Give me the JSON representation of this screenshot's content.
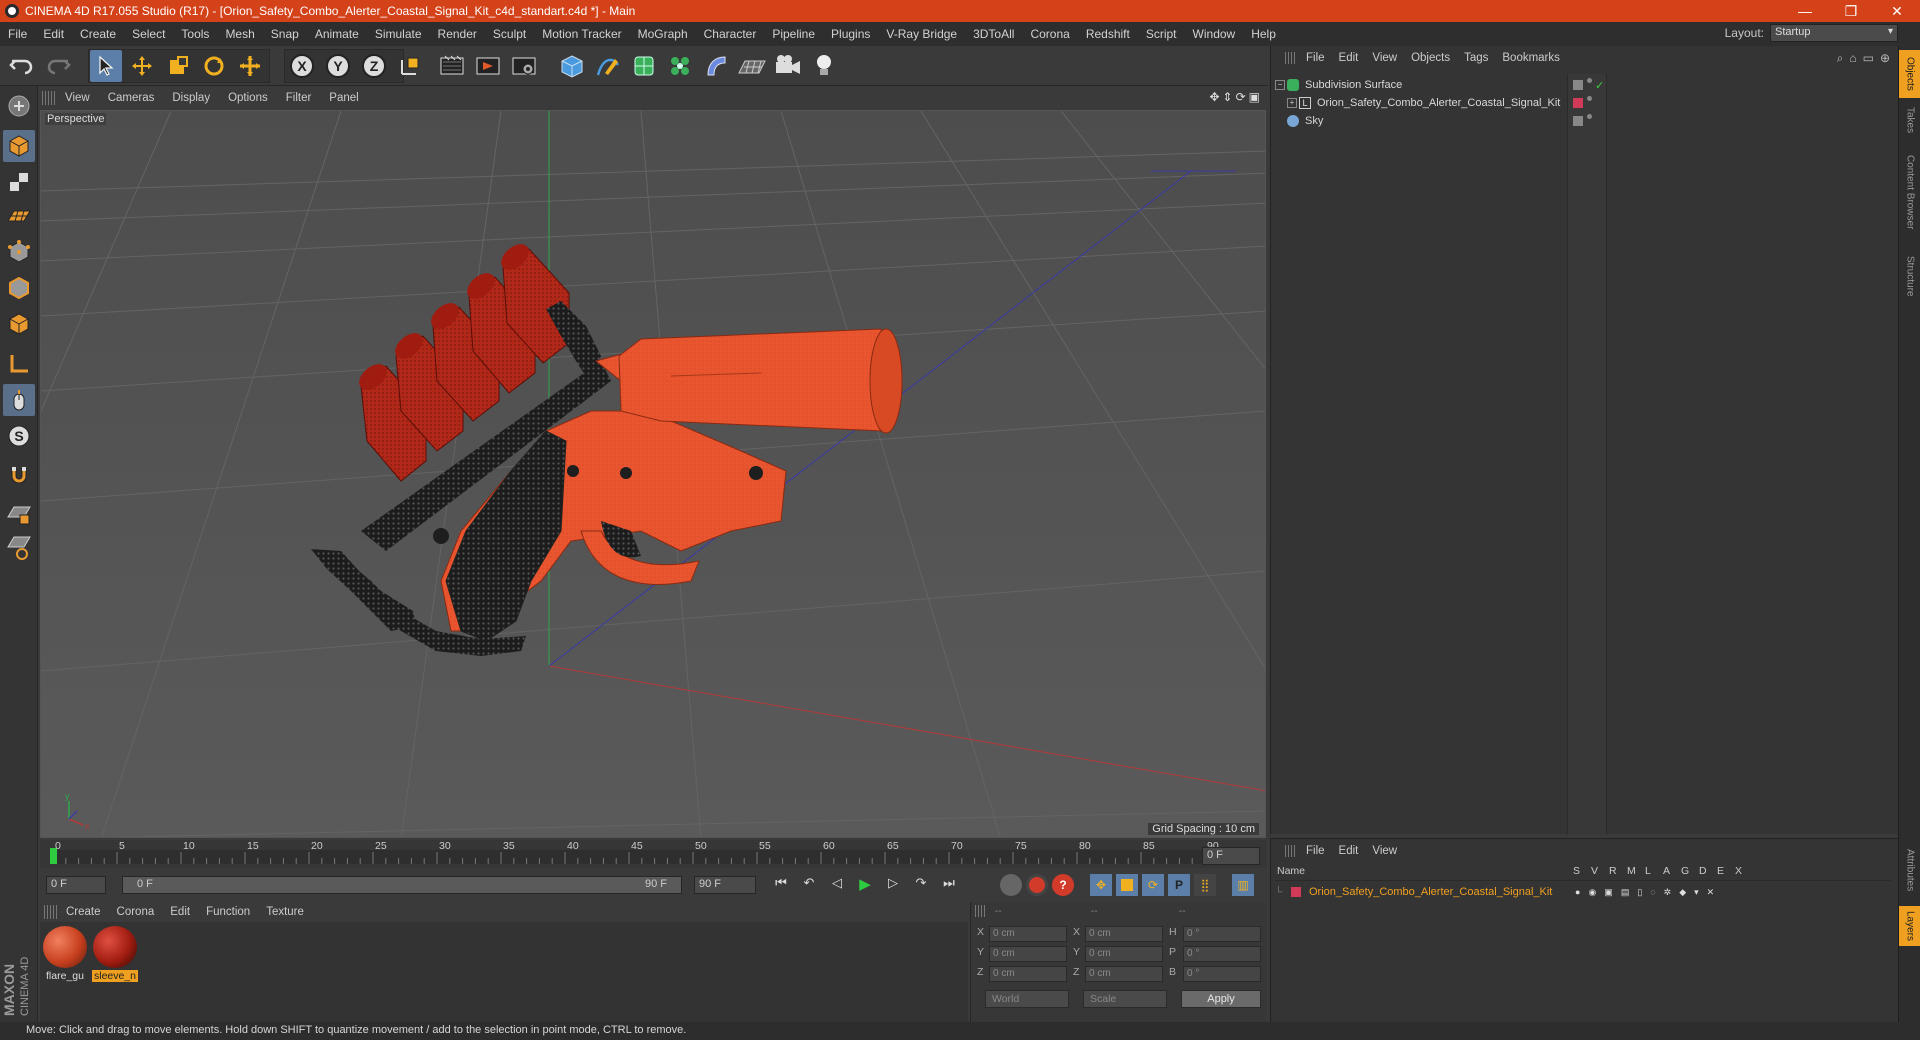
{
  "window": {
    "title": "CINEMA 4D R17.055 Studio (R17) - [Orion_Safety_Combo_Alerter_Coastal_Signal_Kit_c4d_standart.c4d *] - Main",
    "minimize": "—",
    "maximize": "❐",
    "close": "✕"
  },
  "menu": {
    "items": [
      "File",
      "Edit",
      "Create",
      "Select",
      "Tools",
      "Mesh",
      "Snap",
      "Animate",
      "Simulate",
      "Render",
      "Sculpt",
      "Motion Tracker",
      "MoGraph",
      "Character",
      "Pipeline",
      "Plugins",
      "V-Ray Bridge",
      "3DToAll",
      "Corona",
      "Redshift",
      "Script",
      "Window",
      "Help"
    ],
    "layout_label": "Layout:",
    "layout_value": "Startup"
  },
  "viewport": {
    "menu": [
      "View",
      "Cameras",
      "Display",
      "Options",
      "Filter",
      "Panel"
    ],
    "label": "Perspective",
    "grid_spacing": "Grid Spacing : 10 cm"
  },
  "timeline": {
    "ticks": [
      "0",
      "5",
      "10",
      "15",
      "20",
      "25",
      "30",
      "35",
      "40",
      "45",
      "50",
      "55",
      "60",
      "65",
      "70",
      "75",
      "80",
      "85",
      "90"
    ],
    "end_field": "0 F",
    "start_field": "0 F",
    "slider_start": "0 F",
    "slider_end": "90 F",
    "max_field": "90 F"
  },
  "materials": {
    "menu": [
      "Create",
      "Corona",
      "Edit",
      "Function",
      "Texture"
    ],
    "items": [
      {
        "name": "flare_gu",
        "highlight": false
      },
      {
        "name": "sleeve_n",
        "highlight": true
      }
    ]
  },
  "coords": {
    "headers": [
      "--",
      "--",
      "--"
    ],
    "rows": [
      {
        "a": "X",
        "av": "0 cm",
        "b": "X",
        "bv": "0 cm",
        "c": "H",
        "cv": "0 °"
      },
      {
        "a": "Y",
        "av": "0 cm",
        "b": "Y",
        "bv": "0 cm",
        "c": "P",
        "cv": "0 °"
      },
      {
        "a": "Z",
        "av": "0 cm",
        "b": "Z",
        "bv": "0 cm",
        "c": "B",
        "cv": "0 °"
      }
    ],
    "world": "World",
    "scale": "Scale",
    "apply": "Apply"
  },
  "objects": {
    "menu": [
      "File",
      "Edit",
      "View",
      "Objects",
      "Tags",
      "Bookmarks"
    ],
    "items": [
      {
        "name": "Subdivision Surface",
        "indent": 0,
        "color": "#5aa0e0"
      },
      {
        "name": "Orion_Safety_Combo_Alerter_Coastal_Signal_Kit",
        "indent": 1,
        "color": "#dddddd"
      },
      {
        "name": "Sky",
        "indent": 0,
        "color": "#7aa6d6"
      }
    ]
  },
  "layers": {
    "menu": [
      "File",
      "Edit",
      "View"
    ],
    "name_header": "Name",
    "cols": [
      "S",
      "V",
      "R",
      "M",
      "L",
      "A",
      "G",
      "D",
      "E",
      "X"
    ],
    "row": "Orion_Safety_Combo_Alerter_Coastal_Signal_Kit"
  },
  "right_tabs": [
    "Objects",
    "Takes",
    "Content Browser",
    "Structure",
    "Attributes",
    "Layers"
  ],
  "status": "Move: Click and drag to move elements. Hold down SHIFT to quantize movement / add to the selection in point mode, CTRL to remove.",
  "brand": {
    "line1": "MAXON",
    "line2": "CINEMA 4D"
  },
  "colors": {
    "accent": "#d4421a",
    "flare_orange": "#e8552e",
    "cartridge_red": "#b8281a",
    "select_blue": "#5b7fa8"
  }
}
